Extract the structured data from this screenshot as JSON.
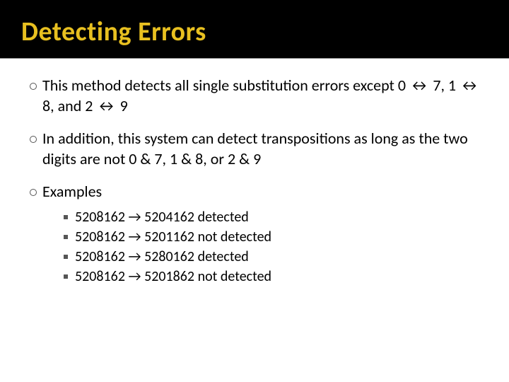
{
  "title": "Detecting Errors",
  "bullets": [
    {
      "text": "This method detects all single substitution errors except 0 ↔ 7, 1 ↔ 8, and 2 ↔ 9"
    },
    {
      "text": "In addition, this system can detect transpositions as long as the two digits are not 0 & 7, 1 & 8, or 2 & 9"
    },
    {
      "text": "Examples"
    }
  ],
  "examples": [
    {
      "text": "5208162 → 5204162 detected"
    },
    {
      "text": "5208162 → 5201162 not detected"
    },
    {
      "text": "5208162 → 5280162 detected"
    },
    {
      "text": "5208162 → 5201862 not detected"
    }
  ]
}
